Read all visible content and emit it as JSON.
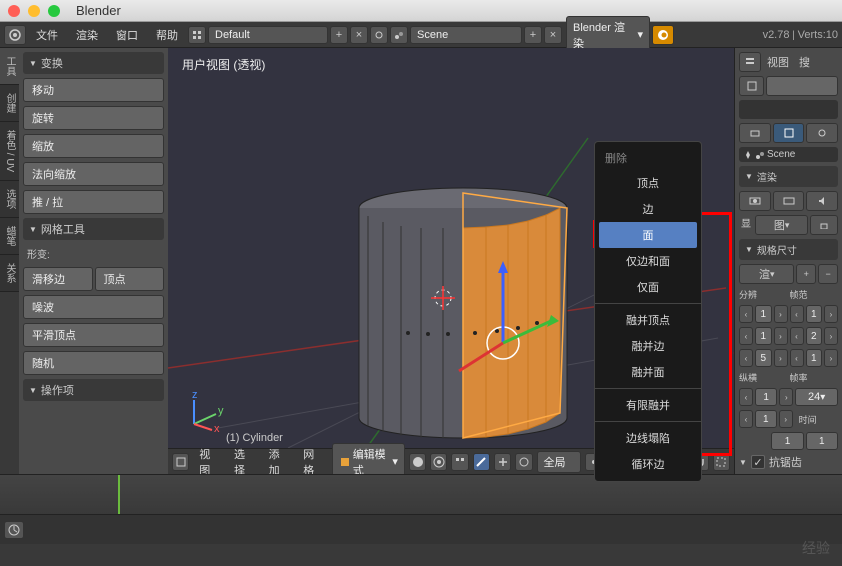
{
  "app": {
    "title": "Blender",
    "version": "v2.78",
    "verts": "Verts:10"
  },
  "topbar": {
    "menus": [
      "文件",
      "渲染",
      "窗口",
      "帮助"
    ],
    "layout": "Default",
    "scene": "Scene",
    "engine": "Blender 渲染"
  },
  "left_tabs": [
    "工具",
    "创建",
    "着色 / UV",
    "选项",
    "蜡笔",
    "关系"
  ],
  "transform": {
    "header": "变换",
    "items": [
      "移动",
      "旋转",
      "缩放",
      "法向缩放",
      "推 / 拉"
    ]
  },
  "mesh_tools": {
    "header": "网格工具",
    "deform_label": "形变:",
    "row1": [
      "滑移边",
      "顶点"
    ],
    "noise": "噪波",
    "smooth": "平滑顶点",
    "random": "随机"
  },
  "operator": {
    "header": "操作项"
  },
  "viewport": {
    "header": "用户视图 (透视)",
    "object": "(1) Cylinder",
    "menus": [
      "视图",
      "选择",
      "添加",
      "网格"
    ],
    "mode": "编辑模式",
    "orientation": "全局"
  },
  "context_menu": {
    "title": "删除",
    "items": [
      "顶点",
      "边",
      "面",
      "仅边和面",
      "仅面",
      "融并顶点",
      "融并边",
      "融并面",
      "有限融并",
      "边线塌陷",
      "循环边"
    ],
    "highlighted_index": 2,
    "separators_after": [
      4,
      7,
      8
    ]
  },
  "right_panel": {
    "view": "视图",
    "search": "搜",
    "scene": "Scene",
    "render_header": "渲染",
    "display": "显",
    "icon_label": "图",
    "dimensions_header": "规格尺寸",
    "render_preset": "渲",
    "res_label": "分辨",
    "frame_range_label": "帧范",
    "res_x": "1",
    "res_y": "1",
    "res_pct": "5",
    "frame_start": "1",
    "frame_end": "2",
    "frame_step": "1",
    "aspect_label": "纵横",
    "fps_label": "帧率",
    "fps": "24",
    "time_label": "时间",
    "aa_label": "抗锯齿"
  },
  "watermark": "经验"
}
